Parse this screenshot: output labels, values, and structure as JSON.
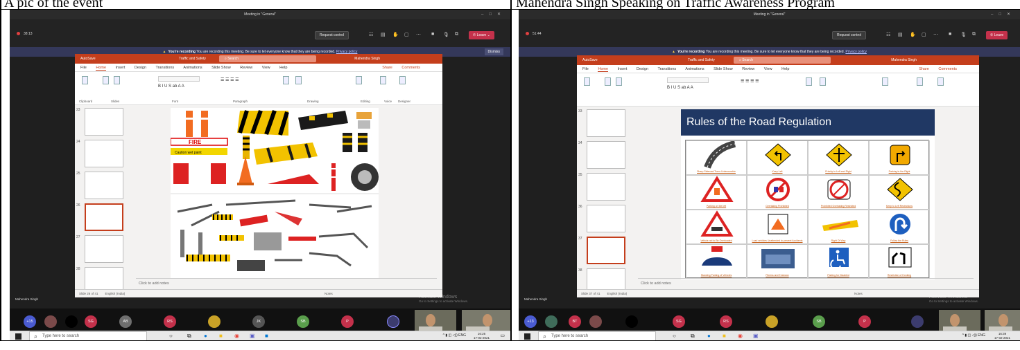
{
  "captions": {
    "left": "A pic of the event",
    "right": "Mahendra Singh Speaking on Traffic Awareness Program"
  },
  "left": {
    "titlebar": "Meeting in \"General\"",
    "timer": "38:13",
    "request_control": "Request control",
    "leave": "Leave",
    "recording": {
      "bold": "You're recording",
      "text": "You are recording this meeting. Be sure to let everyone know that they are being recorded.",
      "link": "Privacy policy",
      "dismiss": "Dismiss"
    },
    "ppt": {
      "autosave": "AutoSave",
      "file_name": "Traffic and Safety",
      "search": "Search",
      "user": "Mahendra Singh",
      "menu": [
        "File",
        "Home",
        "Insert",
        "Design",
        "Transitions",
        "Animations",
        "Slide Show",
        "Review",
        "View",
        "Help"
      ],
      "share": "Share",
      "comments": "Comments",
      "groups": [
        "Clipboard",
        "Slides",
        "Font",
        "Paragraph",
        "Drawing",
        "Editing",
        "Voice",
        "Designer"
      ],
      "ribbon_btns": [
        "Paste",
        "New Slide",
        "Reuse Slides",
        "Layout",
        "Reset",
        "Section",
        "Shapes",
        "Arrange",
        "Quick Styles",
        "Shape Fill",
        "Shape Outline",
        "Shape Effects",
        "Find",
        "Replace",
        "Select",
        "Dictate",
        "Design Ideas"
      ],
      "thumb_nums": [
        "23",
        "24",
        "25",
        "26",
        "27",
        "28"
      ],
      "notes": "Click to add notes",
      "status": [
        "Slide 26 of 41",
        "English (India)",
        "Notes"
      ],
      "fire": "FIRE",
      "caution": "Caution wet paint"
    },
    "activate": "Activate Windows",
    "activate2": "Go to Settings to activate Windows.",
    "speaker": "Mahendra Singh",
    "participants": [
      {
        "i": "+15",
        "c": "#4a5bd1"
      },
      {
        "i": "",
        "c": "#7b4a4a"
      },
      {
        "i": "",
        "c": "#000000"
      },
      {
        "i": "SG",
        "c": "#c4314b"
      },
      {
        "i": "AB",
        "c": "#6f6f6f",
        "n": "ANOUSHKA BOHRA"
      },
      {
        "i": "RS",
        "c": "#c4314b",
        "n": "RIDHIMA SURI"
      },
      {
        "i": "",
        "c": "#c9a227",
        "n": "SOMYA VERMA"
      },
      {
        "i": "JK",
        "c": "#555555"
      },
      {
        "i": "SB",
        "c": "#5a9e4c",
        "n": "Sanjiv Singh Bakri"
      },
      {
        "i": "P",
        "c": "#c4314b",
        "n": "Prashant"
      },
      {
        "i": "",
        "c": "#3c3c6e",
        "n": "Mahendra Singh"
      }
    ],
    "task_search": "Type here to search",
    "time": "16:26",
    "date": "17-02-2021",
    "lang": "ENG"
  },
  "right": {
    "titlebar": "Meeting in \"General\"",
    "timer": "51:44",
    "request_control": "Request control",
    "leave": "Leave",
    "recording": {
      "bold": "You're recording",
      "text": "You are recording this meeting. Be sure to let everyone know that they are being recorded.",
      "link": "Privacy policy"
    },
    "ppt": {
      "autosave": "AutoSave",
      "file_name": "Traffic and Safety",
      "search": "Search",
      "user": "Mahendra Singh",
      "menu": [
        "File",
        "Home",
        "Insert",
        "Design",
        "Transitions",
        "Animations",
        "Slide Show",
        "Review",
        "View",
        "Help"
      ],
      "share": "Share",
      "comments": "Comments",
      "thumb_nums": [
        "33",
        "34",
        "35",
        "36",
        "37",
        "38"
      ],
      "slide_title": "Rules of the Road Regulation",
      "rules": [
        "Sharp Sideroad Turns Unfavourable",
        "Keep Left",
        "Priority to Left and Right",
        "Parking to the Right",
        "Parking on the left",
        "Overtaking Prohibited",
        "Prohibited Overtaking Restricted",
        "Keep to Left Restrictions",
        "Vehicle not to Be Overloaded",
        "Load vehicles Unattended to prevent Accidents",
        "Right Of Way",
        "Follow the Rules",
        "Standing Parking of Vehicles",
        "Fitness and Emission",
        "Parking for Disabled",
        "Restriction of Honking"
      ],
      "notes": "Click to add notes",
      "status": [
        "Slide 37 of 41",
        "English (India)",
        "Notes"
      ]
    },
    "activate": "Activate Windows",
    "activate2": "Go to Settings to activate Windows.",
    "speaker": "Mahendra Singh",
    "participants": [
      {
        "i": "+13",
        "c": "#4a5bd1"
      },
      {
        "i": "",
        "c": "#3f6c5a"
      },
      {
        "i": "BT",
        "c": "#c4314b"
      },
      {
        "i": "",
        "c": "#7b4a4a"
      },
      {
        "i": "",
        "c": "#000000"
      },
      {
        "i": "SG",
        "c": "#c4314b",
        "n": "SRASHTA GARG"
      },
      {
        "i": "RS",
        "c": "#c4314b",
        "n": "RIDHIMA SURI"
      },
      {
        "i": "",
        "c": "#c9a227",
        "n": "SOMYA VERMA"
      },
      {
        "i": "SB",
        "c": "#5a9e4c",
        "n": "Sanjiv Singh Bakri"
      },
      {
        "i": "P",
        "c": "#c4314b",
        "n": "Prashant"
      },
      {
        "i": "",
        "c": "#3c3c6e",
        "n": "Mahendra Singh"
      }
    ],
    "task_search": "Type here to search",
    "time": "16:39",
    "date": "17-02-2021",
    "lang": "ENG"
  }
}
